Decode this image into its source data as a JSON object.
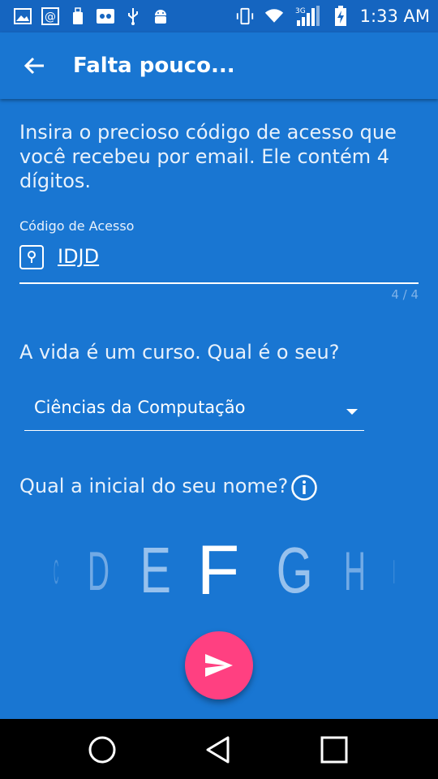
{
  "status_bar": {
    "time": "1:33 AM",
    "network": "3G",
    "left_icons": [
      "gallery-icon",
      "at-sign-icon",
      "usb-storage-icon",
      "voicemail-icon",
      "usb-icon",
      "android-debug-icon"
    ],
    "right_icons": [
      "vibrate-icon",
      "wifi-icon",
      "signal-icon",
      "battery-charging-icon"
    ]
  },
  "app_bar": {
    "title": "Falta pouco...",
    "back_icon": "arrow-back-icon"
  },
  "form": {
    "intro": "Insira o precioso código de acesso que você recebeu por email. Ele contém 4 dígitos.",
    "code_label": "Código de Acesso",
    "code_value": "IDJD",
    "code_counter": "4 / 4",
    "code_icon": "lock-keyhole-icon",
    "course_question": "A vida é um curso. Qual é o seu?",
    "course_selected": "Ciências da Computação",
    "name_question": "Qual a inicial do seu nome?",
    "info_icon": "info-icon",
    "letters": [
      "C",
      "D",
      "E",
      "F",
      "G",
      "H",
      "I"
    ],
    "selected_letter": "F"
  },
  "fab": {
    "icon": "send-icon"
  },
  "nav_bar": {
    "icons": [
      "home-circle-icon",
      "back-triangle-icon",
      "recents-square-icon"
    ]
  },
  "colors": {
    "primary": "#1976d2",
    "status_bar": "#1565c0",
    "accent": "#ff4081",
    "nav_bar": "#000000"
  }
}
